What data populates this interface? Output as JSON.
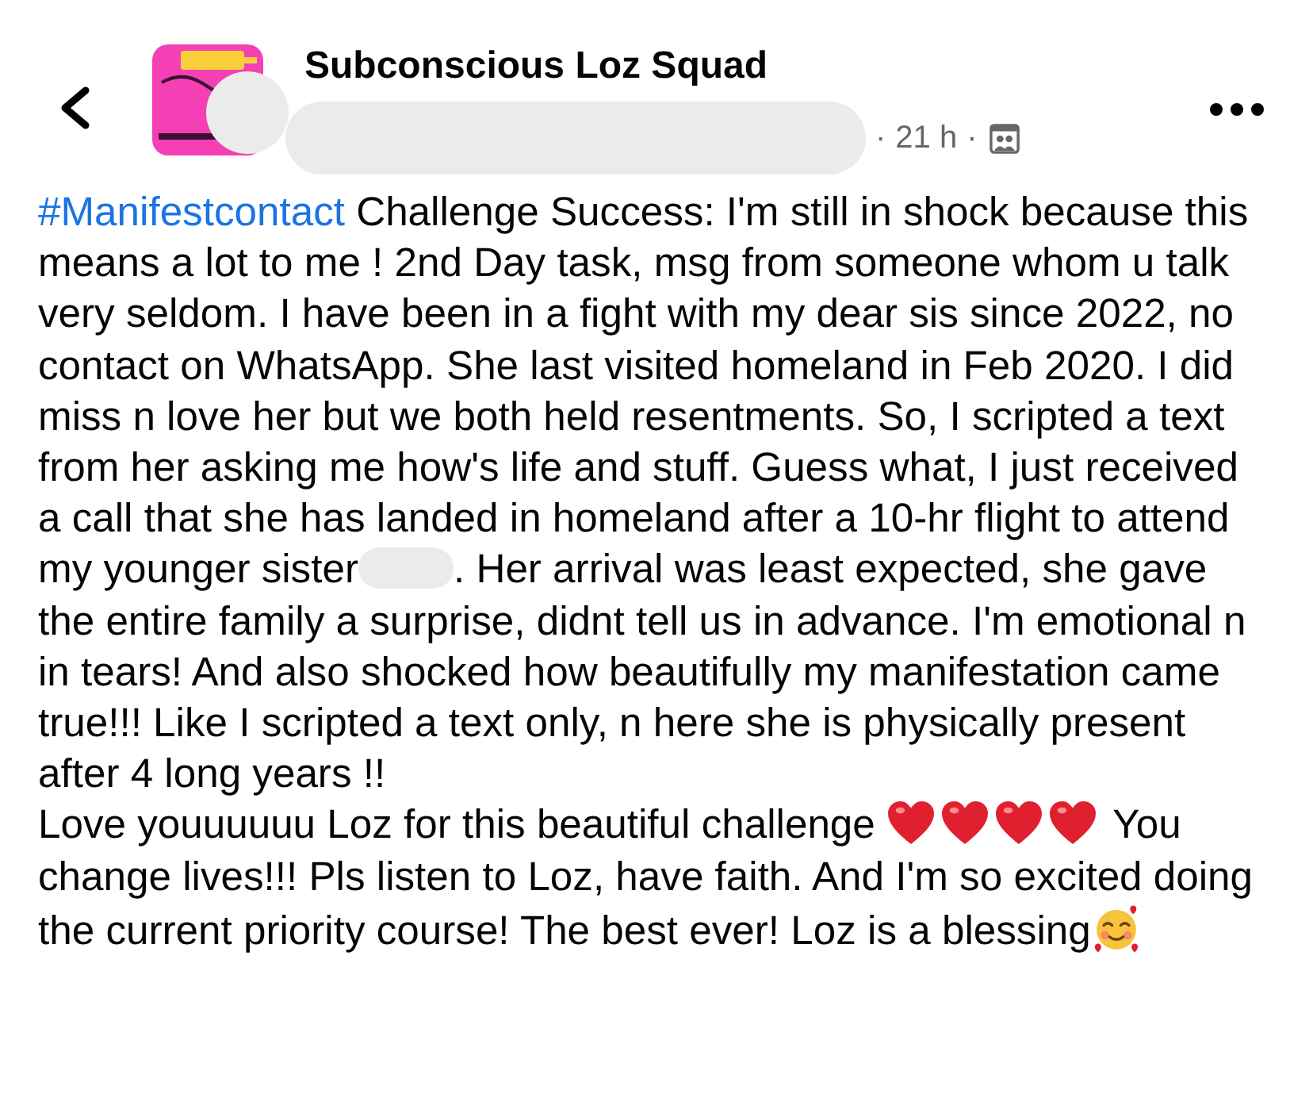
{
  "header": {
    "group_name": "Subconscious Loz Squad",
    "separator_before": "·",
    "time": "21 h",
    "separator_after": "·"
  },
  "post": {
    "hashtag": "#Manifestcontact",
    "text_before_redaction": "Challenge Success: I'm still in shock because this means a lot to me ! 2nd Day task, msg from someone whom u talk very seldom. I have been in a fight with my dear sis since 2022, no contact on WhatsApp. She last visited homeland in Feb 2020. I did miss n love her but we both held resentments. So, I scripted a text from her asking me how's life and stuff. Guess what, I just received a call that she has landed in homeland after a 10-hr flight to attend my younger sister",
    "text_after_redaction": ". Her arrival was least expected, she gave the entire family a surprise, didnt tell us in advance. I'm emotional n in tears! And also shocked how beautifully my manifestation came true!!!  Like I scripted a text only,  n here she is physically present after 4 long years !!",
    "closing_before_hearts": "Love youuuuuu Loz for this beautiful challenge",
    "closing_after_hearts": "You change lives!!! Pls listen to Loz, have faith. And I'm so excited doing the current priority course! The best ever! Loz is a blessing"
  }
}
